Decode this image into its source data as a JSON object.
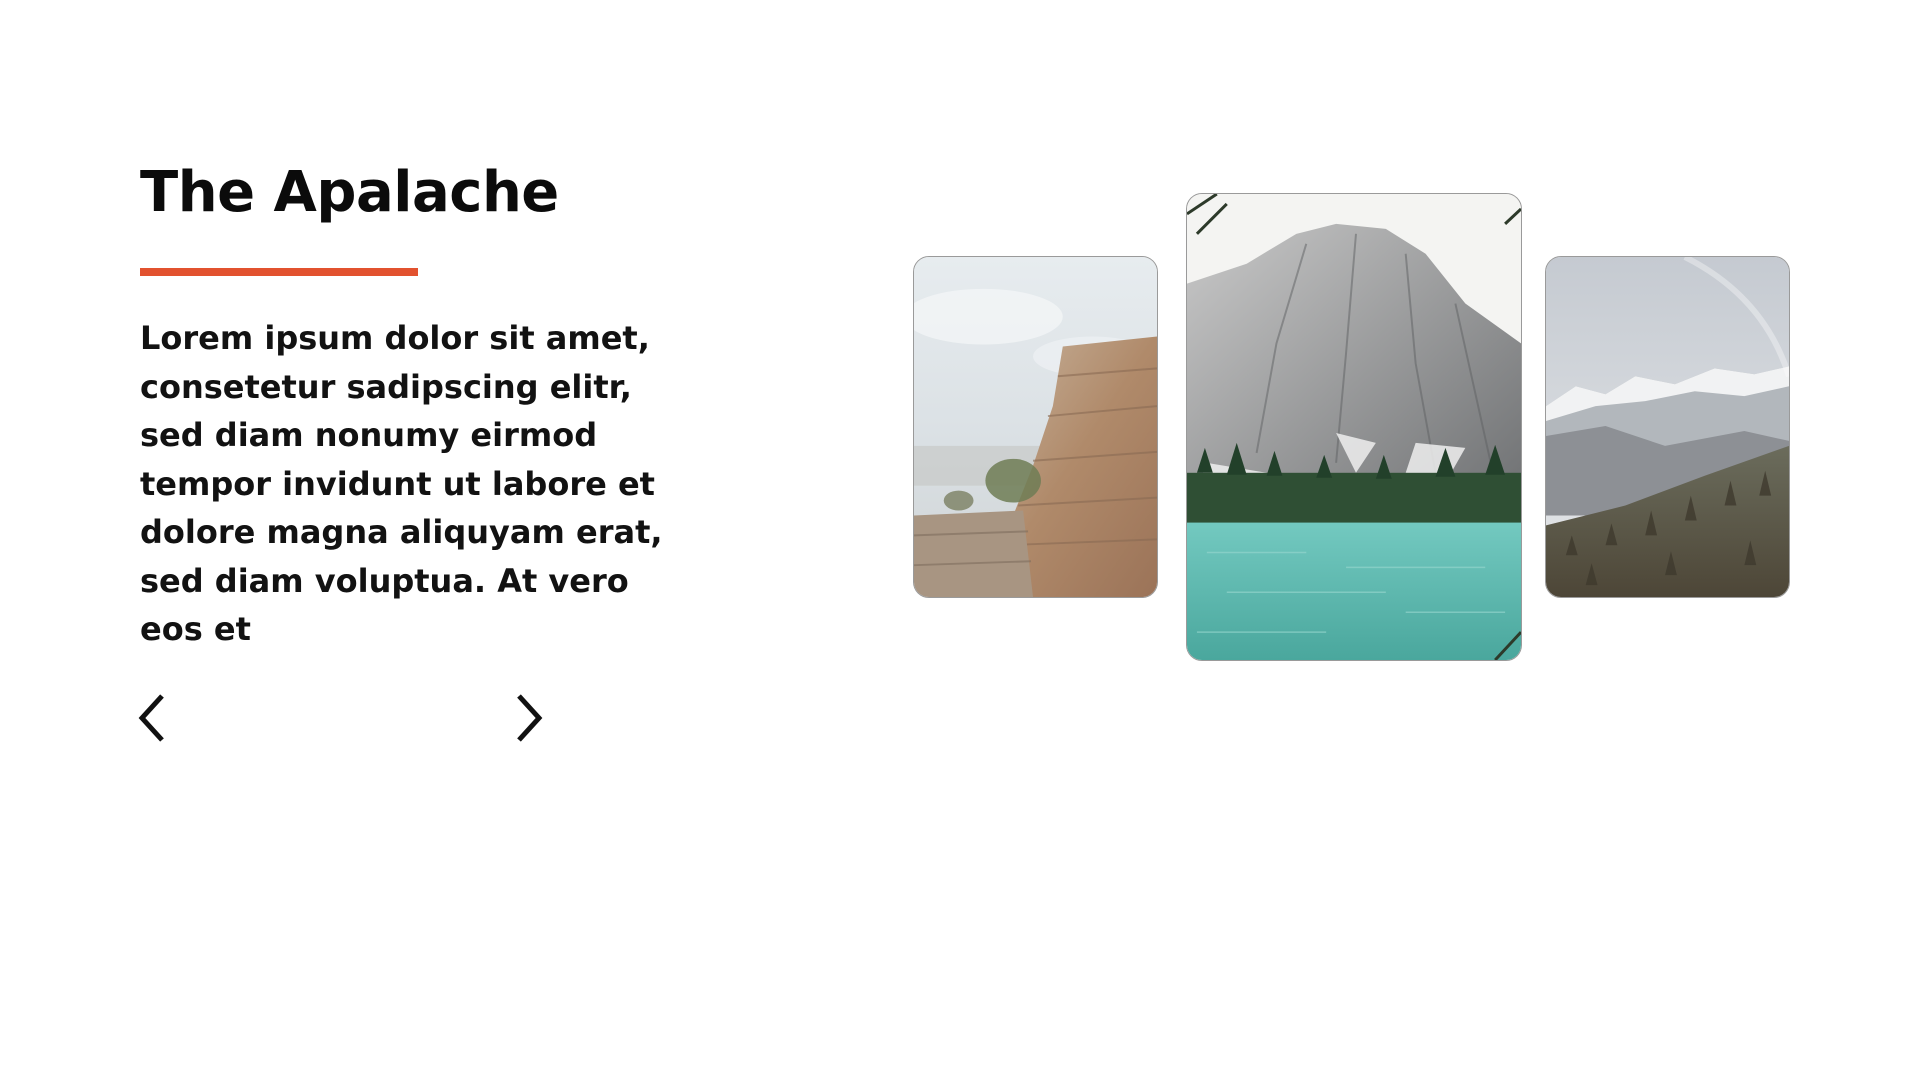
{
  "heading": {
    "title": "The Apalache",
    "accent_color": "#e2522f"
  },
  "body": {
    "text": "Lorem ipsum dolor sit amet, consetetur sadipscing elitr, sed diam nonumy eirmod tempor invidunt ut labore et dolore magna aliquyam erat, sed diam voluptua. At vero eos et"
  },
  "navigation": {
    "prev_icon": "chevron-left-icon",
    "next_icon": "chevron-right-icon"
  },
  "gallery": {
    "images": [
      {
        "name": "canyon-cliff-image",
        "active": false
      },
      {
        "name": "mountain-lake-image",
        "active": true
      },
      {
        "name": "snowy-forest-mountains-image",
        "active": false
      }
    ]
  }
}
